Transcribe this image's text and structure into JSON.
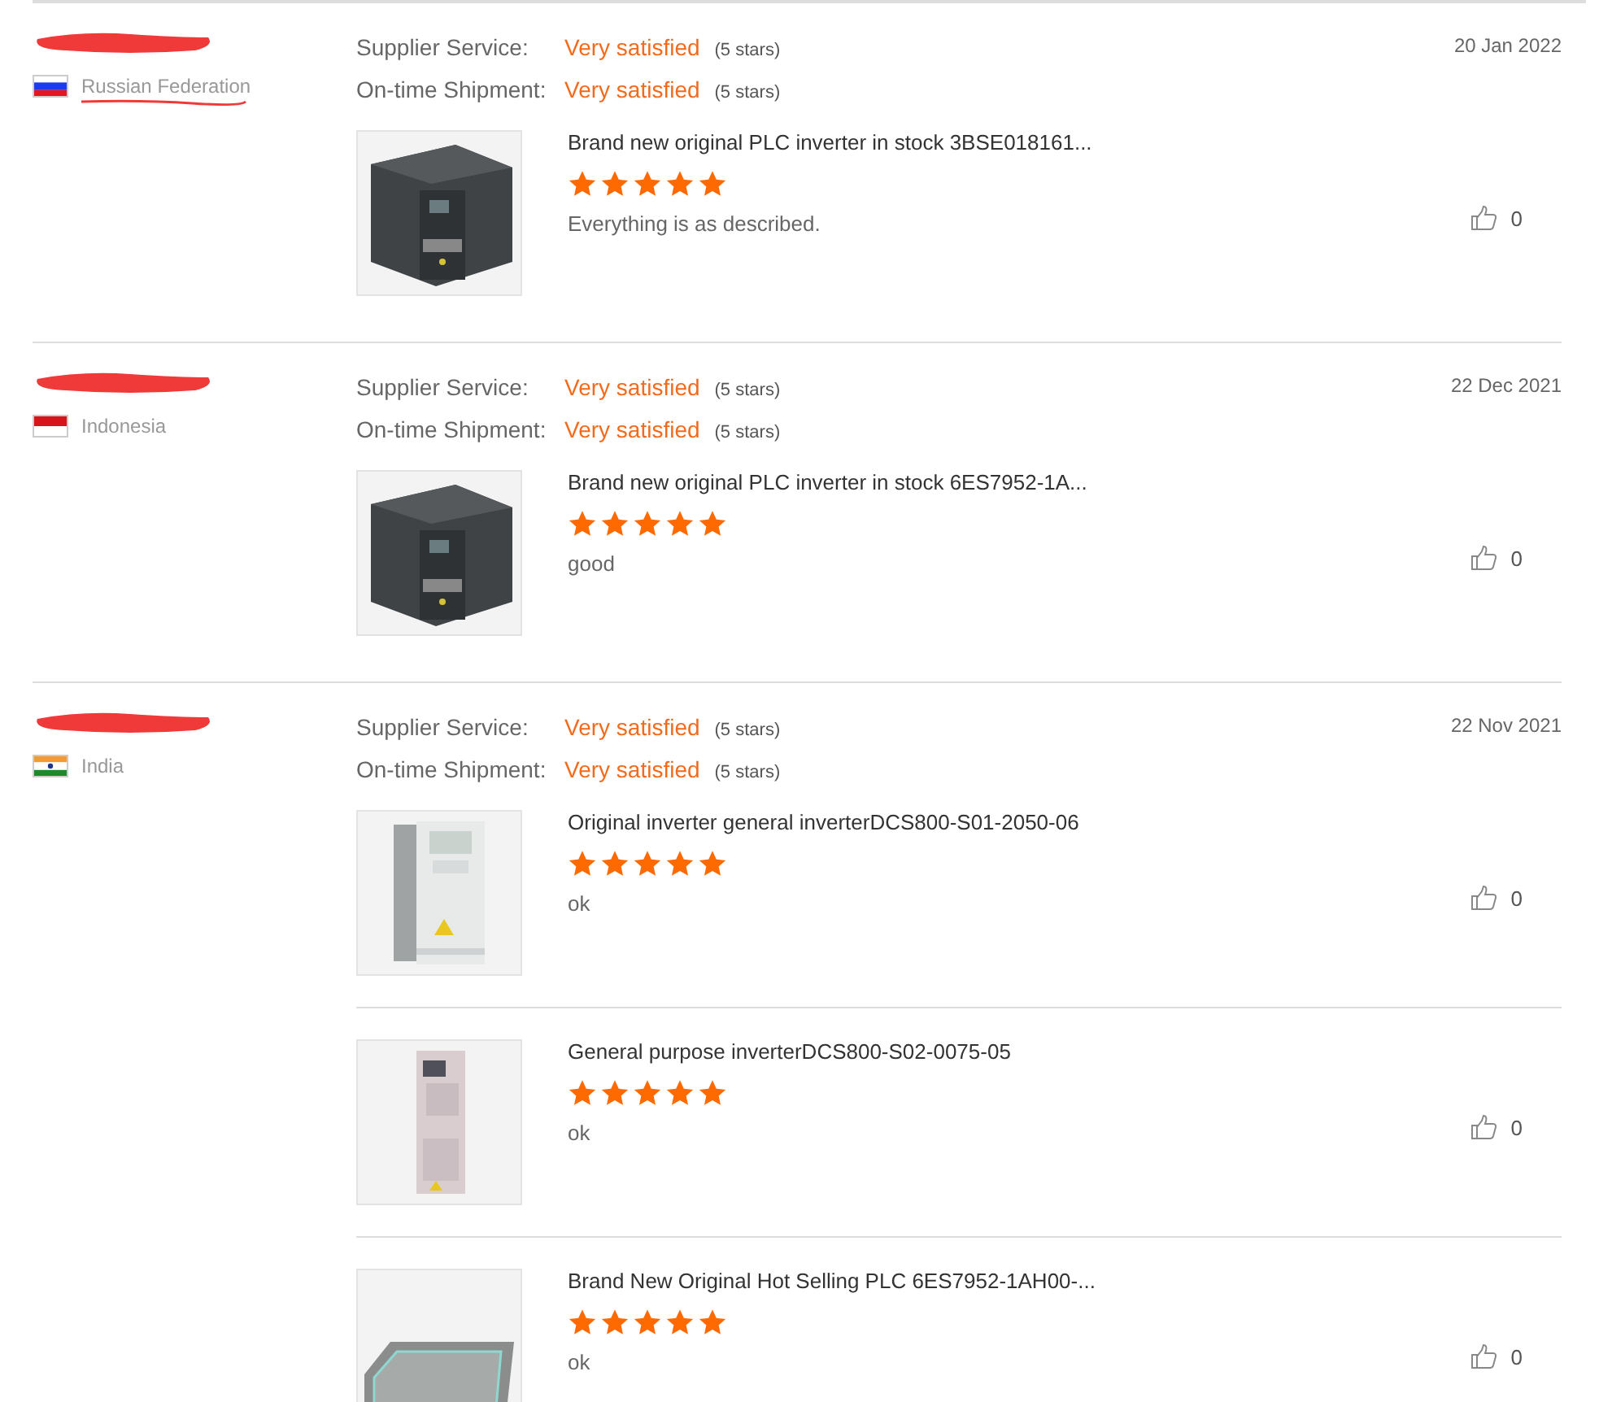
{
  "reviews": [
    {
      "country": "Russian Federation",
      "country_struck": true,
      "kind": "russia",
      "date": "20 Jan 2022",
      "ratings": [
        {
          "label": "Supplier Service:",
          "value": "Very satisfied",
          "note": "(5 stars)"
        },
        {
          "label": "On-time Shipment:",
          "value": "Very satisfied",
          "note": "(5 stars)"
        }
      ],
      "products": [
        {
          "title": "Brand new original PLC inverter in stock 3BSE018161...",
          "stars": 5,
          "comment": "Everything is as described.",
          "likes": "0"
        }
      ]
    },
    {
      "country": "Indonesia",
      "country_struck": false,
      "kind": "indonesia",
      "date": "22 Dec 2021",
      "ratings": [
        {
          "label": "Supplier Service:",
          "value": "Very satisfied",
          "note": "(5 stars)"
        },
        {
          "label": "On-time Shipment:",
          "value": "Very satisfied",
          "note": "(5 stars)"
        }
      ],
      "products": [
        {
          "title": "Brand new original PLC inverter in stock 6ES7952-1A...",
          "stars": 5,
          "comment": "good",
          "likes": "0"
        }
      ]
    },
    {
      "country": "India",
      "country_struck": false,
      "kind": "india",
      "date": "22 Nov 2021",
      "ratings": [
        {
          "label": "Supplier Service:",
          "value": "Very satisfied",
          "note": "(5 stars)"
        },
        {
          "label": "On-time Shipment:",
          "value": "Very satisfied",
          "note": "(5 stars)"
        }
      ],
      "products": [
        {
          "title": "Original inverter general inverterDCS800-S01-2050-06",
          "stars": 5,
          "comment": "ok",
          "likes": "0"
        },
        {
          "title": "General purpose inverterDCS800-S02-0075-05",
          "stars": 5,
          "comment": "ok",
          "likes": "0"
        },
        {
          "title": "Brand New Original Hot Selling PLC 6ES7952-1AH00-...",
          "stars": 5,
          "comment": "ok",
          "likes": "0"
        }
      ]
    }
  ]
}
